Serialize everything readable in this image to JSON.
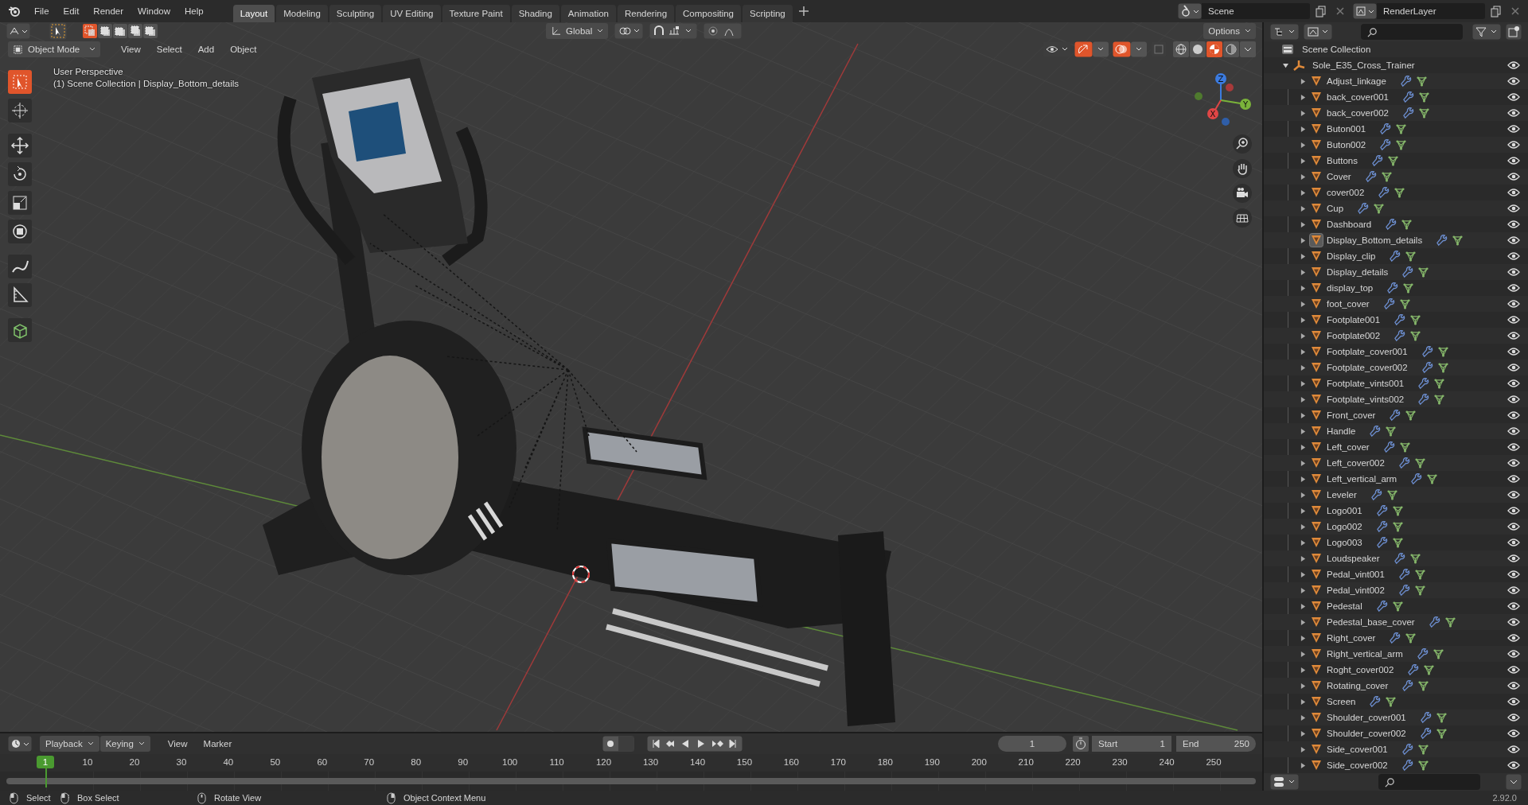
{
  "menu": [
    "File",
    "Edit",
    "Render",
    "Window",
    "Help"
  ],
  "workspace_tabs": [
    {
      "label": "Layout",
      "selected": true
    },
    {
      "label": "Modeling",
      "selected": false
    },
    {
      "label": "Sculpting",
      "selected": false
    },
    {
      "label": "UV Editing",
      "selected": false
    },
    {
      "label": "Texture Paint",
      "selected": false
    },
    {
      "label": "Shading",
      "selected": false
    },
    {
      "label": "Animation",
      "selected": false
    },
    {
      "label": "Rendering",
      "selected": false
    },
    {
      "label": "Compositing",
      "selected": false
    },
    {
      "label": "Scripting",
      "selected": false
    }
  ],
  "scene": {
    "value": "Scene"
  },
  "view_layer": {
    "value": "RenderLayer"
  },
  "select_modes": [
    {
      "selected": true
    },
    {
      "selected": false
    },
    {
      "selected": false
    },
    {
      "selected": false
    },
    {
      "selected": false
    }
  ],
  "orientation": {
    "value": "Global"
  },
  "mode": {
    "value": "Object Mode"
  },
  "viewport_menu": [
    "View",
    "Select",
    "Add",
    "Object"
  ],
  "options": {
    "label": "Options"
  },
  "gizmos_on": true,
  "overlays_on": true,
  "shading": [
    {
      "kind": "wireframe",
      "selected": false
    },
    {
      "kind": "solid",
      "selected": false
    },
    {
      "kind": "material",
      "selected": true
    },
    {
      "kind": "rendered",
      "selected": false
    }
  ],
  "tools": [
    {
      "kind": "select",
      "selected": true
    },
    {
      "kind": "cursor",
      "selected": false
    },
    {
      "kind": "move",
      "selected": false
    },
    {
      "kind": "rotate",
      "selected": false
    },
    {
      "kind": "scale",
      "selected": false
    },
    {
      "kind": "transform",
      "selected": false
    },
    {
      "kind": "annotate",
      "selected": false
    },
    {
      "kind": "measure",
      "selected": false
    },
    {
      "kind": "add-cube",
      "selected": false
    }
  ],
  "viewport": {
    "view_name": "User Perspective",
    "info": "(1) Scene Collection | Display_Bottom_details",
    "gizmo_axes": [
      "X",
      "Y",
      "Z"
    ]
  },
  "outliner": {
    "root": "Scene Collection",
    "collection": {
      "name": "Sole_E35_Cross_Trainer",
      "expanded": true,
      "children": [
        {
          "name": "Adjust_linkage",
          "selected": false,
          "expanded": false
        },
        {
          "name": "back_cover001",
          "selected": false,
          "expanded": false
        },
        {
          "name": "back_cover002",
          "selected": false,
          "expanded": false
        },
        {
          "name": "Buton001",
          "selected": false,
          "expanded": false
        },
        {
          "name": "Buton002",
          "selected": false,
          "expanded": false
        },
        {
          "name": "Buttons",
          "selected": false,
          "expanded": false
        },
        {
          "name": "Cover",
          "selected": false,
          "expanded": false
        },
        {
          "name": "cover002",
          "selected": false,
          "expanded": false
        },
        {
          "name": "Cup",
          "selected": false,
          "expanded": false
        },
        {
          "name": "Dashboard",
          "selected": false,
          "expanded": false
        },
        {
          "name": "Display_Bottom_details",
          "selected": true,
          "expanded": false
        },
        {
          "name": "Display_clip",
          "selected": false,
          "expanded": false
        },
        {
          "name": "Display_details",
          "selected": false,
          "expanded": false
        },
        {
          "name": "display_top",
          "selected": false,
          "expanded": false
        },
        {
          "name": "foot_cover",
          "selected": false,
          "expanded": false
        },
        {
          "name": "Footplate001",
          "selected": false,
          "expanded": false
        },
        {
          "name": "Footplate002",
          "selected": false,
          "expanded": false
        },
        {
          "name": "Footplate_cover001",
          "selected": false,
          "expanded": false
        },
        {
          "name": "Footplate_cover002",
          "selected": false,
          "expanded": false
        },
        {
          "name": "Footplate_vints001",
          "selected": false,
          "expanded": false
        },
        {
          "name": "Footplate_vints002",
          "selected": false,
          "expanded": false
        },
        {
          "name": "Front_cover",
          "selected": false,
          "expanded": false
        },
        {
          "name": "Handle",
          "selected": false,
          "expanded": false
        },
        {
          "name": "Left_cover",
          "selected": false,
          "expanded": false
        },
        {
          "name": "Left_cover002",
          "selected": false,
          "expanded": false
        },
        {
          "name": "Left_vertical_arm",
          "selected": false,
          "expanded": false
        },
        {
          "name": "Leveler",
          "selected": false,
          "expanded": false
        },
        {
          "name": "Logo001",
          "selected": false,
          "expanded": false
        },
        {
          "name": "Logo002",
          "selected": false,
          "expanded": false
        },
        {
          "name": "Logo003",
          "selected": false,
          "expanded": false
        },
        {
          "name": "Loudspeaker",
          "selected": false,
          "expanded": false
        },
        {
          "name": "Pedal_vint001",
          "selected": false,
          "expanded": false
        },
        {
          "name": "Pedal_vint002",
          "selected": false,
          "expanded": false
        },
        {
          "name": "Pedestal",
          "selected": false,
          "expanded": false
        },
        {
          "name": "Pedestal_base_cover",
          "selected": false,
          "expanded": false
        },
        {
          "name": "Right_cover",
          "selected": false,
          "expanded": false
        },
        {
          "name": "Right_vertical_arm",
          "selected": false,
          "expanded": false
        },
        {
          "name": "Roght_cover002",
          "selected": false,
          "expanded": false
        },
        {
          "name": "Rotating_cover",
          "selected": false,
          "expanded": false
        },
        {
          "name": "Screen",
          "selected": false,
          "expanded": false
        },
        {
          "name": "Shoulder_cover001",
          "selected": false,
          "expanded": false
        },
        {
          "name": "Shoulder_cover002",
          "selected": false,
          "expanded": false
        },
        {
          "name": "Side_cover001",
          "selected": false,
          "expanded": false
        },
        {
          "name": "Side_cover002",
          "selected": false,
          "expanded": false
        }
      ]
    }
  },
  "timeline": {
    "dropdown_menus": [
      "Playback",
      "Keying"
    ],
    "menus": [
      "View",
      "Marker"
    ],
    "current_frame": "1",
    "start_label": "Start",
    "start": "1",
    "end_label": "End",
    "end": "250",
    "playhead": "1",
    "ruler": [
      "10",
      "20",
      "30",
      "40",
      "50",
      "60",
      "70",
      "80",
      "90",
      "100",
      "110",
      "120",
      "130",
      "140",
      "150",
      "160",
      "170",
      "180",
      "190",
      "200",
      "210",
      "220",
      "230",
      "240",
      "250"
    ]
  },
  "status_bar": {
    "hints": [
      {
        "kind": "left",
        "label": "Select"
      },
      {
        "kind": "drag",
        "label": "Box Select"
      },
      {
        "kind": "middle",
        "label": "Rotate View"
      },
      {
        "kind": "right",
        "label": "Object Context Menu"
      }
    ],
    "version": "2.92.0"
  }
}
